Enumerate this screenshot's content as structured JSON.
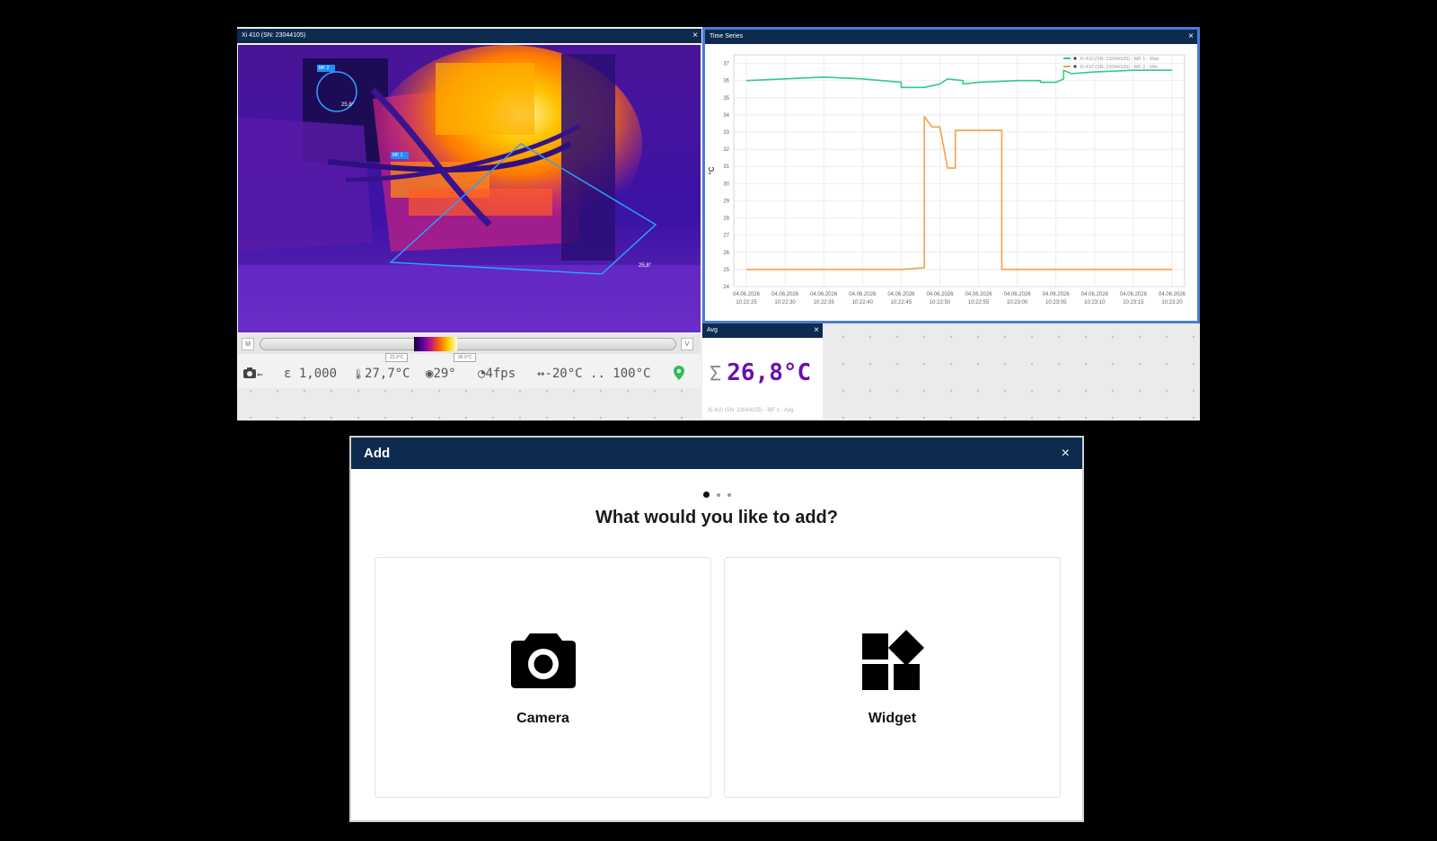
{
  "camera_panel": {
    "title": "Xi 410 (SN: 23044105)",
    "close": "×",
    "measure_areas": [
      {
        "label": "MF 2",
        "value": "25,8°"
      },
      {
        "label": "MF 1",
        "value": "25,8°"
      }
    ],
    "scale": {
      "left_button": "M",
      "right_button": "V",
      "min_tag": "23.9°C",
      "max_tag": "36.0°C"
    },
    "status": {
      "camera_icon": "camera-icon",
      "usb_icon": "usb-icon",
      "emissivity": "1,000",
      "ambient_temp": "27,7°C",
      "fov": "29°",
      "framerate": "4fps",
      "range": "-20°C .. 100°C"
    }
  },
  "timeseries_panel": {
    "title": "Time Series",
    "close": "×"
  },
  "avg_panel": {
    "title": "Avg",
    "close": "×",
    "value": "26,8°C",
    "caption": "Xi 410 (SN: 23044105) - MF 1 - Avg"
  },
  "dialog": {
    "title": "Add",
    "close": "×",
    "page_count": 3,
    "active_page": 1,
    "question": "What would you like to add?",
    "options": [
      {
        "label": "Camera",
        "icon": "camera-icon"
      },
      {
        "label": "Widget",
        "icon": "widgets-icon"
      }
    ]
  },
  "chart_data": {
    "type": "line",
    "title": "",
    "xlabel": "",
    "ylabel": "°C",
    "ylim": [
      24,
      37.5
    ],
    "yticks": [
      24,
      25,
      26,
      27,
      28,
      29,
      30,
      31,
      32,
      33,
      34,
      35,
      36,
      37
    ],
    "xlim": [
      "10:22:25",
      "10:23:20"
    ],
    "x_tick_dates": [
      "04.06.2026",
      "04.06.2026",
      "04.06.2026",
      "04.06.2026",
      "04.06.2026",
      "04.06.2026",
      "04.06.2026",
      "04.06.2026",
      "04.06.2026",
      "04.06.2026",
      "04.06.2026",
      "04.06.2026"
    ],
    "x_tick_times": [
      "10:22:25",
      "10:22:30",
      "10:22:35",
      "10:22:40",
      "10:22:45",
      "10:22:50",
      "10:22:55",
      "10:23:00",
      "10:23:05",
      "10:23:10",
      "10:23:15",
      "10:23:20"
    ],
    "grid": true,
    "legend_position": "top-right",
    "series": [
      {
        "name": "Xi 410 (SN: 23044105) - MF 1 - Max",
        "color": "#2ecc85",
        "points": [
          [
            "10:22:25",
            36.0
          ],
          [
            "10:22:30",
            36.1
          ],
          [
            "10:22:35",
            36.2
          ],
          [
            "10:22:40",
            36.1
          ],
          [
            "10:22:45",
            35.9
          ],
          [
            "10:22:45",
            35.6
          ],
          [
            "10:22:48",
            35.6
          ],
          [
            "10:22:50",
            35.8
          ],
          [
            "10:22:51",
            36.1
          ],
          [
            "10:22:53",
            36.0
          ],
          [
            "10:22:53",
            35.8
          ],
          [
            "10:22:55",
            35.9
          ],
          [
            "10:23:00",
            36.0
          ],
          [
            "10:23:03",
            36.0
          ],
          [
            "10:23:03",
            35.9
          ],
          [
            "10:23:05",
            35.9
          ],
          [
            "10:23:06",
            36.1
          ],
          [
            "10:23:06",
            36.6
          ],
          [
            "10:23:07",
            36.4
          ],
          [
            "10:23:10",
            36.5
          ],
          [
            "10:23:15",
            36.6
          ],
          [
            "10:23:20",
            36.6
          ]
        ]
      },
      {
        "name": "Xi 410 (SN: 23044105) - MF 2 - Min",
        "color": "#f5a04a",
        "points": [
          [
            "10:22:25",
            25.0
          ],
          [
            "10:22:30",
            25.0
          ],
          [
            "10:22:35",
            25.0
          ],
          [
            "10:22:40",
            25.0
          ],
          [
            "10:22:45",
            25.0
          ],
          [
            "10:22:48",
            25.1
          ],
          [
            "10:22:48",
            33.9
          ],
          [
            "10:22:49",
            33.3
          ],
          [
            "10:22:50",
            33.3
          ],
          [
            "10:22:51",
            30.9
          ],
          [
            "10:22:52",
            30.9
          ],
          [
            "10:22:52",
            33.1
          ],
          [
            "10:22:55",
            33.1
          ],
          [
            "10:22:58",
            33.1
          ],
          [
            "10:22:58",
            25.0
          ],
          [
            "10:23:00",
            25.0
          ],
          [
            "10:23:05",
            25.0
          ],
          [
            "10:23:10",
            25.0
          ],
          [
            "10:23:15",
            25.0
          ],
          [
            "10:23:20",
            25.0
          ]
        ]
      }
    ]
  }
}
